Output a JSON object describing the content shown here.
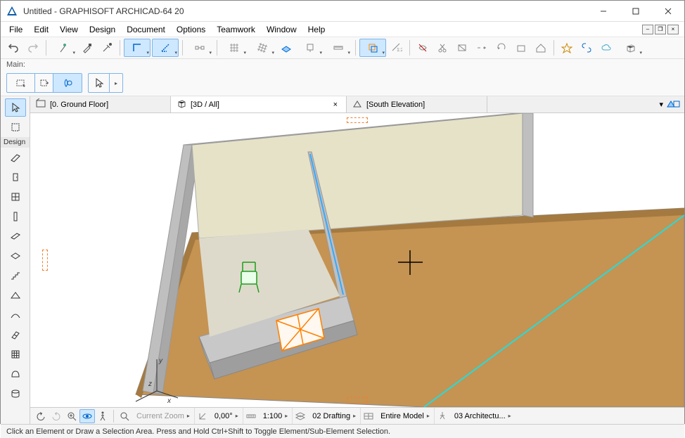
{
  "title": "Untitled - GRAPHISOFT ARCHICAD-64 20",
  "menus": [
    "File",
    "Edit",
    "View",
    "Design",
    "Document",
    "Options",
    "Teamwork",
    "Window",
    "Help"
  ],
  "toolbar_label": "Main:",
  "tabs": {
    "ground_floor": "[0. Ground Floor]",
    "view_3d": "[3D / All]",
    "south_elevation": "[South Elevation]"
  },
  "left_section": "Design",
  "status_footer": "Click an Element or Draw a Selection Area. Press and Hold Ctrl+Shift to Toggle Element/Sub-Element Selection.",
  "status_top": {
    "zoom_label": "Current Zoom",
    "angle": "0,00°",
    "scale": "1:100",
    "layer_combo": "02 Drafting",
    "model_view": "Entire Model",
    "dim_set": "03 Architectu..."
  }
}
